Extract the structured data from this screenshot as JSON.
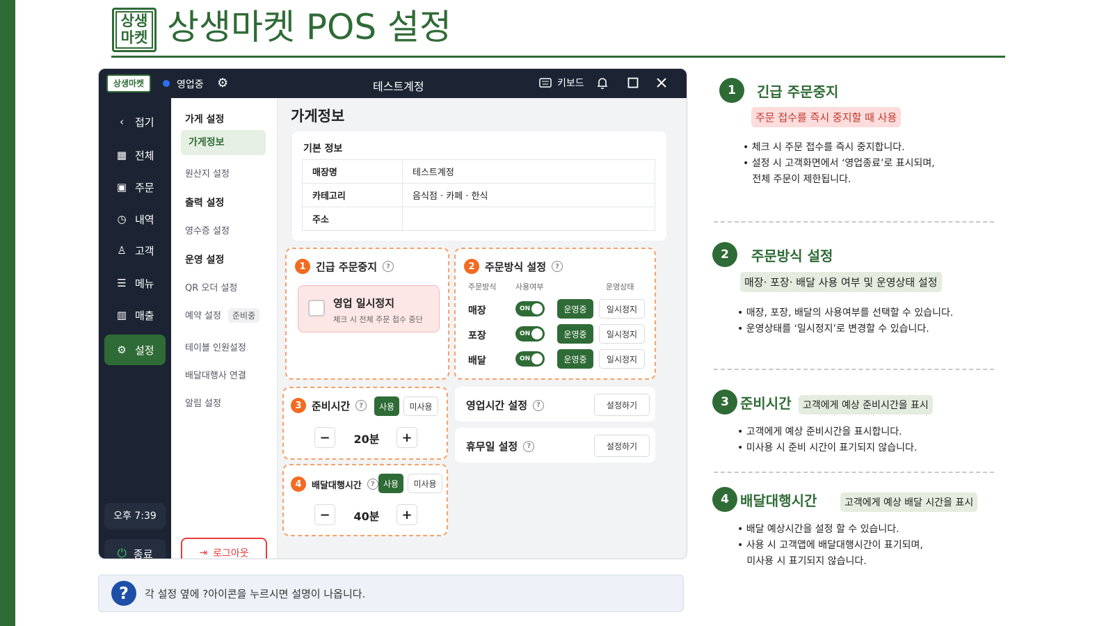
{
  "header": {
    "logo_text": "상생\n마켓",
    "title": "상생마켓 POS 설정"
  },
  "window": {
    "logo": "상생마켓",
    "status": "영업중",
    "account": "테스트계정",
    "keyboard": "키보드"
  },
  "sidebar": {
    "items": [
      {
        "label": "접기",
        "icon": "chevron-left"
      },
      {
        "label": "전체",
        "icon": "grid"
      },
      {
        "label": "주문",
        "icon": "clipboard"
      },
      {
        "label": "내역",
        "icon": "history"
      },
      {
        "label": "고객",
        "icon": "user"
      },
      {
        "label": "메뉴",
        "icon": "list"
      },
      {
        "label": "매출",
        "icon": "bar-chart"
      },
      {
        "label": "설정",
        "icon": "gear"
      }
    ],
    "time": "오후 7:39",
    "exit": "종료"
  },
  "submenu": {
    "groups": [
      {
        "head": "가게 설정",
        "items": [
          "가게정보",
          "원산지 설정"
        ]
      },
      {
        "head": "출력 설정",
        "items": [
          "영수증 설정"
        ]
      },
      {
        "head": "운영 설정",
        "items": [
          "QR 오더 설정",
          "예약 설정",
          "테이블 인원설정",
          "배달대행사 연결",
          "알림 설정"
        ]
      }
    ],
    "reservation_badge": "준비중",
    "logout": "로그아웃"
  },
  "content": {
    "title": "가게정보",
    "basic": {
      "heading": "기본 정보",
      "rows": [
        {
          "key": "매장명",
          "value": "테스트계정"
        },
        {
          "key": "카테고리",
          "value": "음식점 · 카페 · 한식"
        },
        {
          "key": "주소",
          "value": ""
        }
      ]
    },
    "emergency": {
      "num": "1",
      "title": "긴급 주문중지",
      "box_title": "영업 일시정지",
      "box_sub": "체크 시 전체 주문 접수 중단"
    },
    "order_method": {
      "num": "2",
      "title": "주문방식 설정",
      "col_method": "주문방식",
      "col_use": "사용여부",
      "col_status": "운영상태",
      "rows": [
        {
          "name": "매장",
          "toggle": "ON",
          "on": "운영중",
          "off": "일시정지"
        },
        {
          "name": "포장",
          "toggle": "ON",
          "on": "운영중",
          "off": "일시정지"
        },
        {
          "name": "배달",
          "toggle": "ON",
          "on": "운영중",
          "off": "일시정지"
        }
      ]
    },
    "prep": {
      "num": "3",
      "title": "준비시간",
      "use": "사용",
      "nouse": "미사용",
      "value": "20분"
    },
    "delivery": {
      "num": "4",
      "title": "배달대행시간",
      "use": "사용",
      "nouse": "미사용",
      "value": "40분"
    },
    "hours": {
      "title": "영업시간 설정",
      "button": "설정하기"
    },
    "holiday": {
      "title": "휴무일 설정",
      "button": "설정하기"
    }
  },
  "help_bar": {
    "text": "각 설정 옆에 ?아이콘을 누르시면 설명이 나옵니다."
  },
  "guide": [
    {
      "num": "1",
      "title": "긴급 주문중지",
      "tag": "주문 접수를 즉시 중지할 때 사용",
      "bullets": "• 체크 시 주문 접수를 즉시 중지합니다.\n• 설정 시 고객화면에서 ‘영업종료’로 표시되며,\n   전체 주문이 제한됩니다."
    },
    {
      "num": "2",
      "title": "주문방식 설정",
      "tag": "매장· 포장· 배달 사용 여부 및 운영상태 설정",
      "bullets": "• 매장, 포장, 배달의 사용여부를 선택할 수 있습니다.\n• 운영상태를 ‘일시정지’로 변경할 수 있습니다."
    },
    {
      "num": "3",
      "title": "준비시간",
      "tag": "고객에게 예상 준비시간을 표시",
      "bullets": "• 고객에게 예상 준비시간을 표시합니다.\n• 미사용 시 준비 시간이 표기되지 않습니다."
    },
    {
      "num": "4",
      "title": "배달대행시간",
      "tag": "고객에게 예상 배달 시간을 표시",
      "bullets": "• 배달 예상시간을 설정 할 수 있습니다.\n• 사용 시 고객앱에 배달대행시간이 표기되며,\n   미사용 시 표기되지 않습니다."
    }
  ],
  "colors": {
    "brand": "#2f6b36",
    "accent": "#f26b21",
    "dark": "#1c2433",
    "danger": "#e53c3c"
  }
}
